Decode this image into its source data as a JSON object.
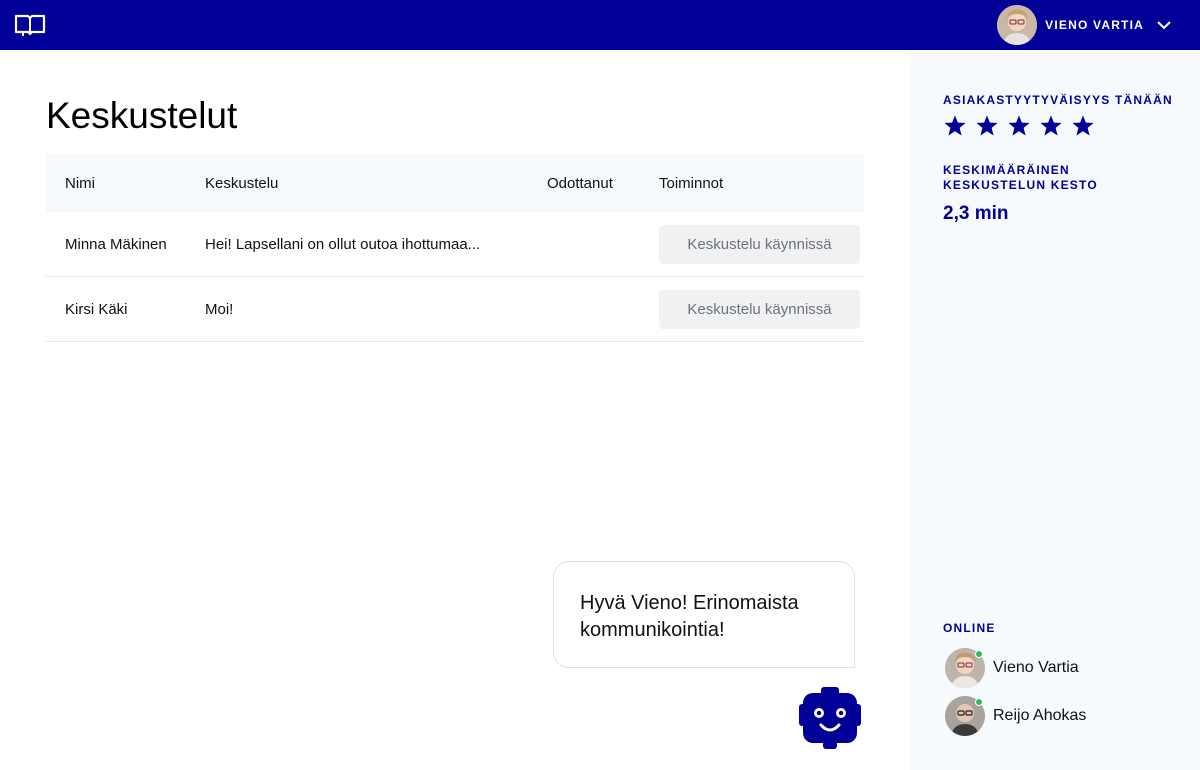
{
  "topbar": {
    "logo_icon": "open-book-icon",
    "user_name": "VIENO VARTIA",
    "menu_icon": "chevron-down-icon",
    "bg_color": "#000099"
  },
  "main": {
    "title": "Keskustelut",
    "table": {
      "headers": [
        "Nimi",
        "Keskustelu",
        "Odottanut",
        "Toiminnot"
      ],
      "rows": [
        {
          "name": "Minna Mäkinen",
          "message": "Hei! Lapsellani on ollut outoa ihottumaa...",
          "waited": "",
          "action": "Keskustelu käynnissä"
        },
        {
          "name": "Kirsi Käki",
          "message": "Moi!",
          "waited": "",
          "action": "Keskustelu käynnissä"
        }
      ]
    }
  },
  "sidebar": {
    "satisfaction_label": "ASIAKASTYYTYVÄISYYS TÄNÄÄN",
    "satisfaction_stars": 5,
    "avg_duration_label_line1": "KESKIMÄÄRÄINEN",
    "avg_duration_label_line2": "KESKUSTELUN KESTO",
    "avg_duration_value": "2,3 min",
    "online_label": "ONLINE",
    "online_users": [
      {
        "name": "Vieno Vartia",
        "status": "online"
      },
      {
        "name": "Reijo Ahokas",
        "status": "online"
      }
    ]
  },
  "bot": {
    "message_line1": "Hyvä Vieno! Erinomaista",
    "message_line2": "kommunikointia!",
    "icon": "robot-face-icon"
  },
  "colors": {
    "accent": "#000099",
    "online": "#2bbb5a",
    "sidebar_bg": "#f7fafd"
  }
}
